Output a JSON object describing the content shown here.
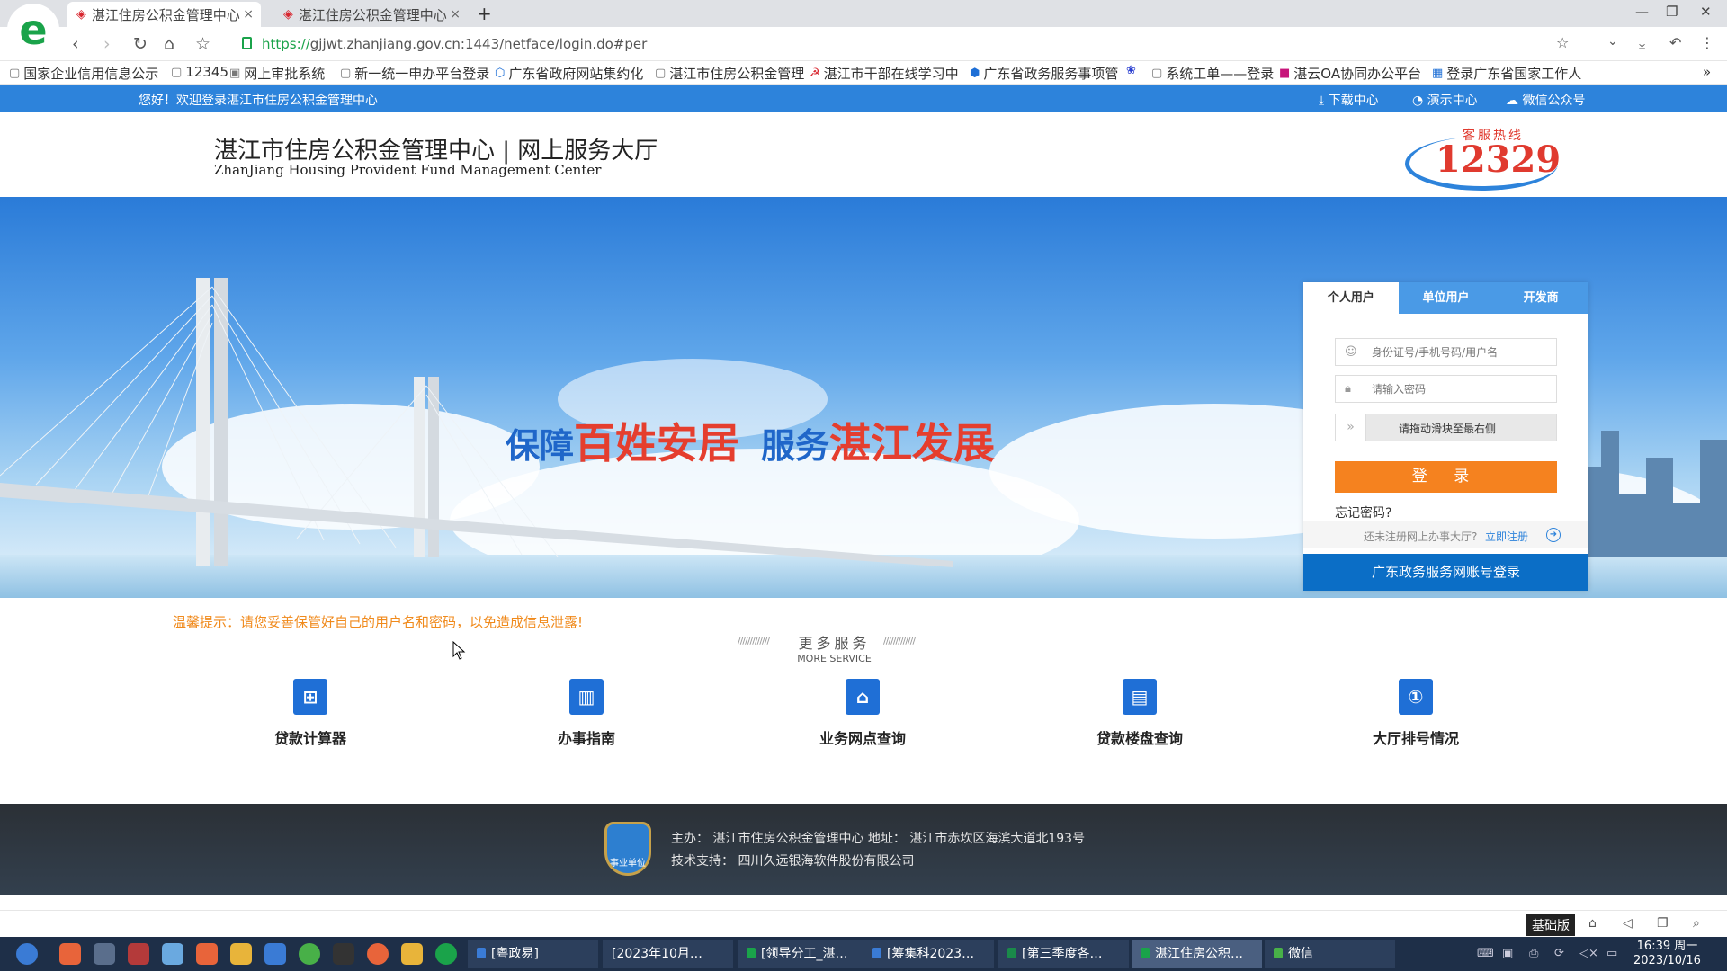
{
  "browser": {
    "tabs": [
      {
        "label": "湛江住房公积金管理中心"
      },
      {
        "label": "湛江住房公积金管理中心"
      }
    ],
    "url_https": "https://",
    "url_rest": "gjjwt.zhanjiang.gov.cn:1443/netface/login.do#per",
    "bookmarks": [
      "国家企业信用信息公示",
      "12345",
      "网上审批系统",
      "新一统一申办平台登录",
      "广东省政府网站集约化",
      "湛江市住房公积金管理",
      "湛江市干部在线学习中",
      "广东省政务服务事项管",
      "",
      "系统工单——登录",
      "湛云OA协同办公平台",
      "登录广东省国家工作人"
    ]
  },
  "page": {
    "welcome": "您好！欢迎登录湛江市住房公积金管理中心",
    "toplinks": [
      "下载中心",
      "演示中心",
      "微信公众号"
    ],
    "title": "湛江市住房公积金管理中心 | 网上服务大厅",
    "subtitle": "ZhanJiang Housing Provident Fund Management Center",
    "hotline_label": "客服热线",
    "hotline_number": "12329",
    "slogan": [
      "保障",
      "百姓安居",
      "服务",
      "湛江发展"
    ],
    "login": {
      "tabs": [
        "个人用户",
        "单位用户",
        "开发商"
      ],
      "username_placeholder": "身份证号/手机号码/用户名",
      "password_placeholder": "请输入密码",
      "slider_text": "请拖动滑块至最右侧",
      "login_button": "登 录",
      "forgot": "忘记密码?",
      "register_prompt": "还未注册网上办事大厅?",
      "register_link": "立即注册",
      "gd_login": "广东政务服务网账号登录"
    },
    "tip": "温馨提示：请您妥善保管好自己的用户名和密码，以免造成信息泄露!",
    "more_title": "更多服务",
    "more_sub": "MORE SERVICE",
    "services": [
      "贷款计算器",
      "办事指南",
      "业务网点查询",
      "贷款楼盘查询",
      "大厅排号情况"
    ],
    "footer_line1": "主办： 湛江市住房公积金管理中心 地址： 湛江市赤坎区海滨大道北193号",
    "footer_line2": "技术支持： 四川久远银海软件股份有限公司",
    "badge": "事业单位"
  },
  "statusbar": {
    "basic": "基础版"
  },
  "taskbar": {
    "tasks": [
      "[粤政易]",
      "[2023年10月…",
      "[领导分工_湛…",
      "[筹集科2023…",
      "[第三季度各…",
      "湛江住房公积…",
      "微信"
    ],
    "time": "16:39 周一",
    "date": "2023/10/16"
  }
}
